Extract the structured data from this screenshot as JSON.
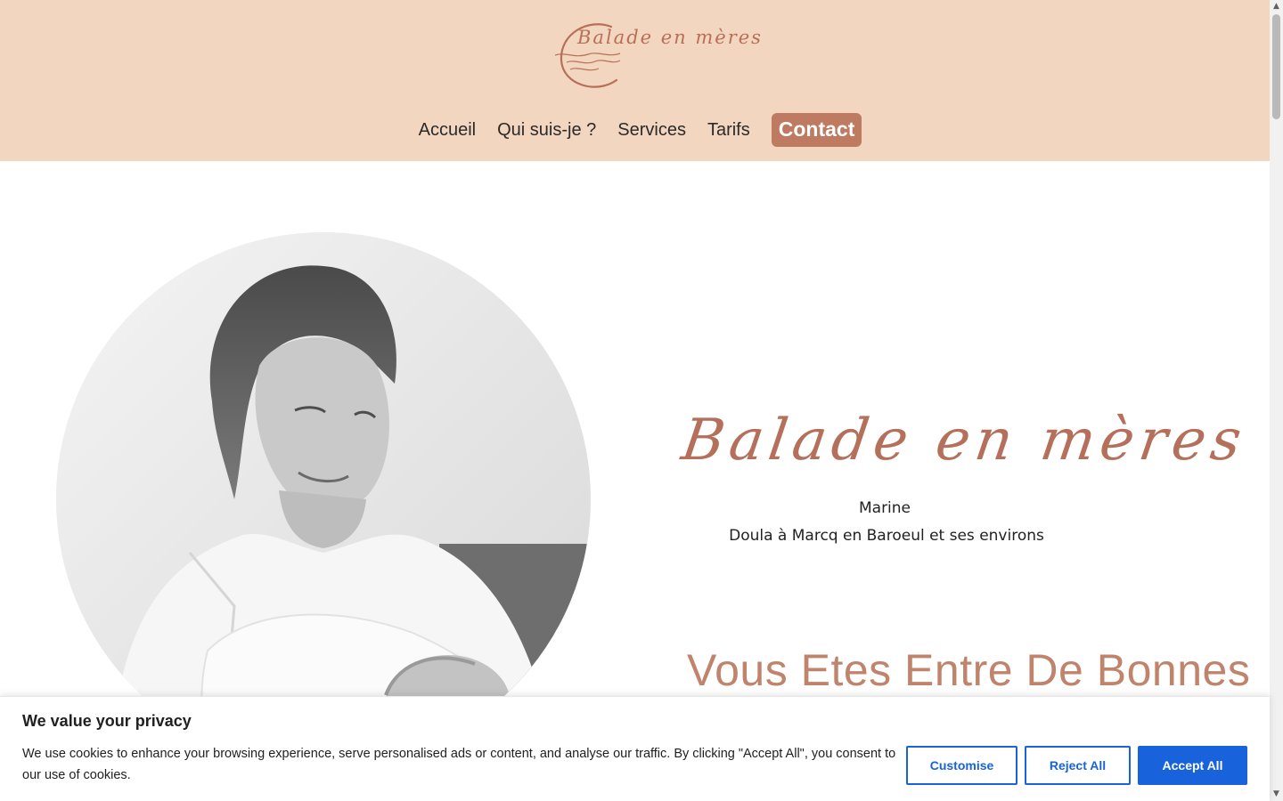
{
  "header": {
    "logo_text": "Balade en mères",
    "background_color": "#f3d6bf"
  },
  "nav": {
    "items": [
      {
        "label": "Accueil"
      },
      {
        "label": "Qui suis-je ?"
      },
      {
        "label": "Services"
      },
      {
        "label": "Tarifs"
      }
    ],
    "contact_label": "Contact",
    "contact_color": "#bf7a62"
  },
  "hero": {
    "brand_script": "Balade en mères",
    "name": "Marine",
    "subtitle": "Doula à Marcq en Baroeul et ses environs",
    "heading": "Vous Etes Entre De Bonnes",
    "accent_color": "#b4705a"
  },
  "cookie": {
    "title": "We value your privacy",
    "text": "We use cookies to enhance your browsing experience, serve personalised ads or content, and analyse our traffic. By clicking \"Accept All\", you consent to our use of cookies.",
    "customise_label": "Customise",
    "reject_label": "Reject All",
    "accept_label": "Accept All",
    "button_color": "#1863dc"
  },
  "scrollbar": {
    "up_icon": "▲",
    "down_icon": "▼"
  }
}
